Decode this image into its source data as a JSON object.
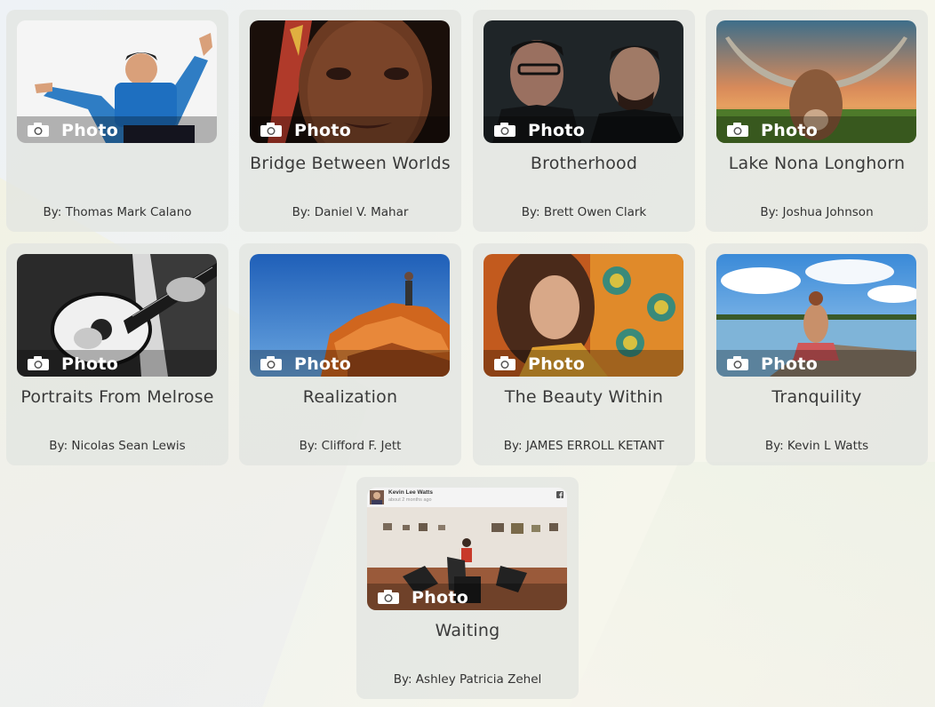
{
  "cards": [
    {
      "badge": "Photo",
      "title": "",
      "byline": "By: Thomas Mark Calano"
    },
    {
      "badge": "Photo",
      "title": "Bridge Between Worlds",
      "byline": "By: Daniel V. Mahar"
    },
    {
      "badge": "Photo",
      "title": "Brotherhood",
      "byline": "By: Brett Owen Clark"
    },
    {
      "badge": "Photo",
      "title": "Lake Nona Longhorn",
      "byline": "By: Joshua Johnson"
    },
    {
      "badge": "Photo",
      "title": "Portraits From Melrose",
      "byline": "By: Nicolas Sean Lewis"
    },
    {
      "badge": "Photo",
      "title": "Realization",
      "byline": "By: Clifford F. Jett"
    },
    {
      "badge": "Photo",
      "title": "The Beauty Within",
      "byline": "By: JAMES ERROLL KETANT"
    },
    {
      "badge": "Photo",
      "title": "Tranquility",
      "byline": "By: Kevin L Watts"
    },
    {
      "badge": "Photo",
      "title": "Waiting",
      "byline": "By: Ashley Patricia Zehel",
      "embedded_post": {
        "author": "Kevin Lee Watts",
        "time": "about 2 months ago"
      }
    }
  ],
  "icons": {
    "badge_icon": "camera-icon",
    "social_icon": "facebook-icon"
  },
  "colors": {
    "card_bg": "#e2e4e0",
    "title_text": "#3a3a3a",
    "badge_text": "#ffffff"
  }
}
